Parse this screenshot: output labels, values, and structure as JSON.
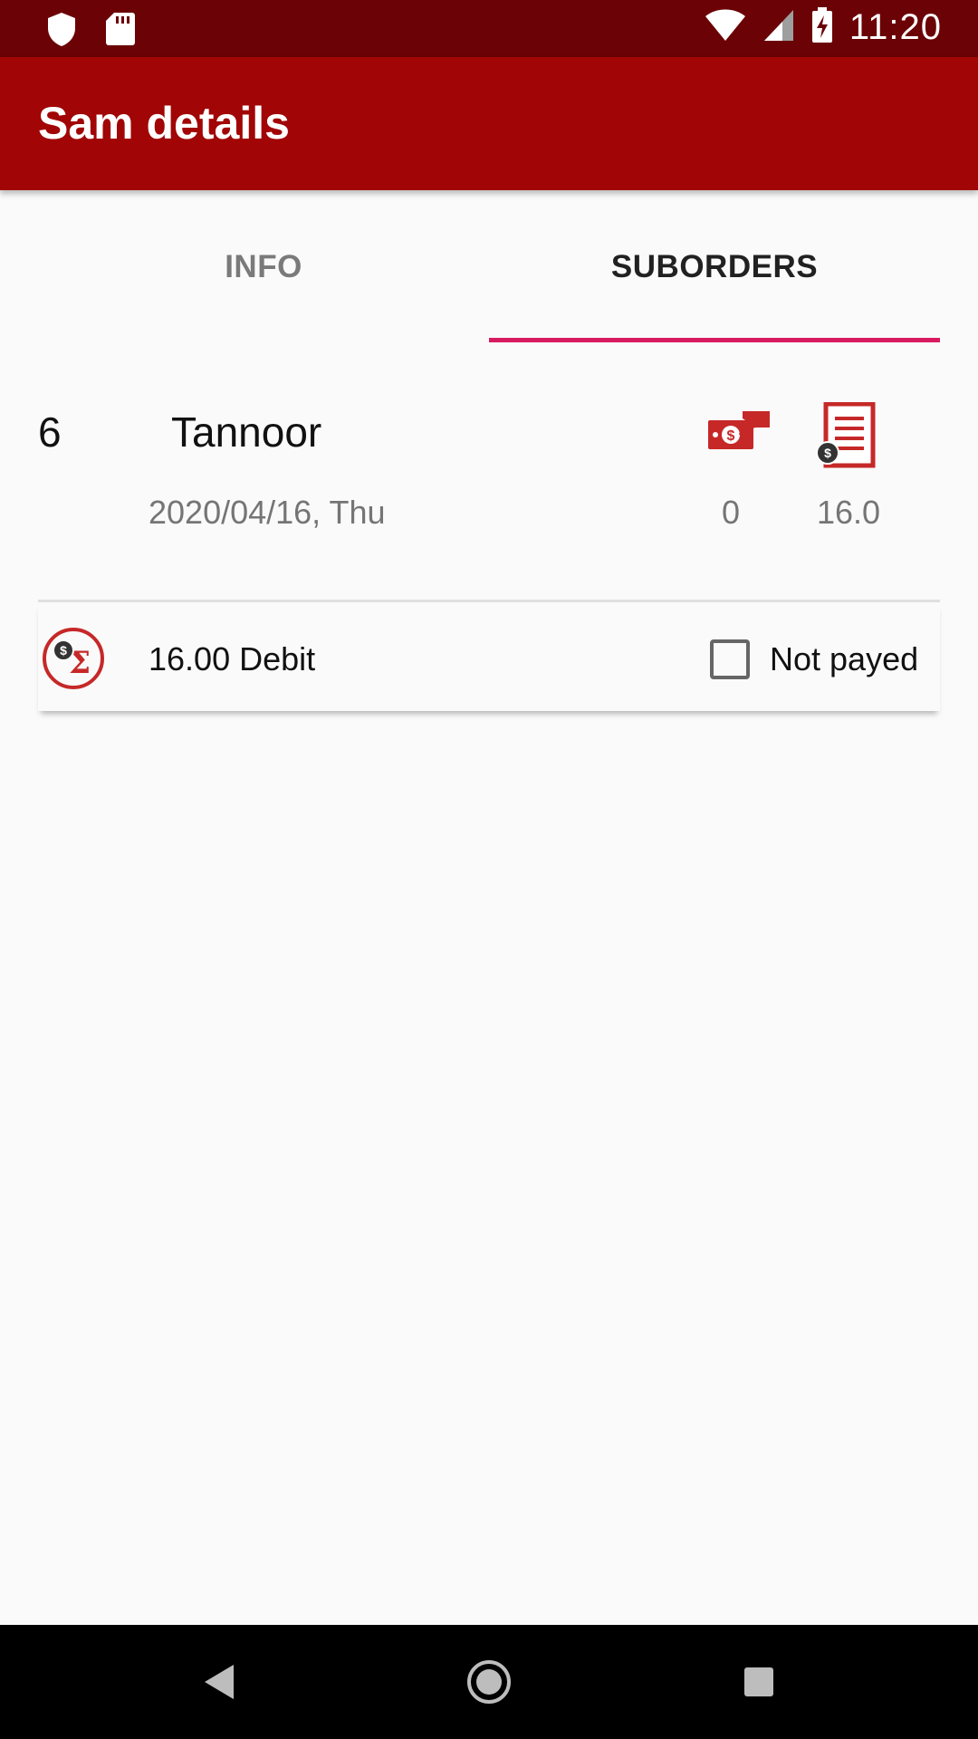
{
  "status_bar": {
    "time": "11:20",
    "icons": [
      "shield-icon",
      "sd-card-icon",
      "wifi-icon",
      "signal-icon",
      "battery-charging-icon"
    ]
  },
  "app_bar": {
    "title": "Sam details"
  },
  "tabs": [
    {
      "label": "INFO",
      "selected": false
    },
    {
      "label": "SUBORDERS",
      "selected": true
    }
  ],
  "suborder": {
    "number": "6",
    "name": "Tannoor",
    "date": "2020/04/16, Thu",
    "paid_amount": "0",
    "bill_amount": "16.0",
    "icons": [
      "cash-payment-icon",
      "bill-icon"
    ]
  },
  "summary": {
    "icon": "sum-money-icon",
    "text": "16.00 Debit",
    "checkbox_label": "Not payed",
    "checked": false
  },
  "colors": {
    "status_bar": "#6b0205",
    "app_bar": "#a10505",
    "tab_indicator": "#d81b60",
    "icon_red": "#c62828"
  }
}
